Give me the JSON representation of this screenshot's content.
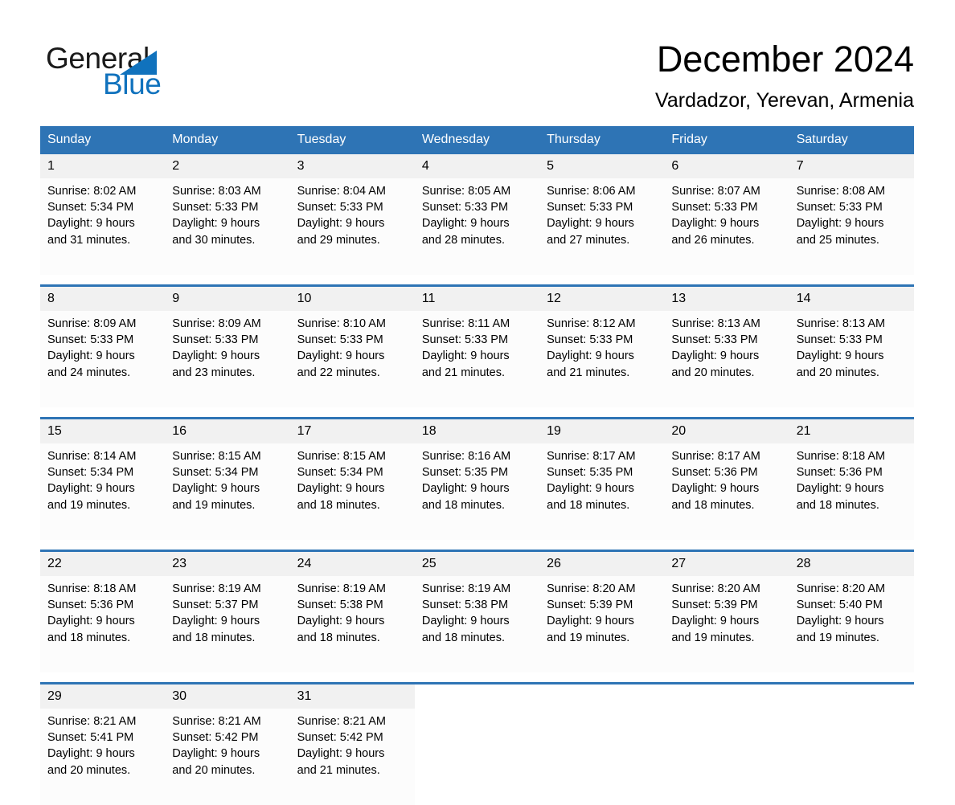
{
  "brand": {
    "word_one": "General",
    "word_two": "Blue",
    "triangle_color": "#1072bd",
    "text_color": "#1a1a1a"
  },
  "header": {
    "month_title": "December 2024",
    "location": "Vardadzor, Yerevan, Armenia"
  },
  "theme": {
    "header_blue": "#2e74b5",
    "daynum_background": "#f1f1f1",
    "cell_background": "#fcfcfc",
    "page_background": "#ffffff"
  },
  "calendar": {
    "weekday_headers": [
      "Sunday",
      "Monday",
      "Tuesday",
      "Wednesday",
      "Thursday",
      "Friday",
      "Saturday"
    ],
    "weeks": [
      {
        "days": [
          {
            "day": "1",
            "sunrise": "Sunrise: 8:02 AM",
            "sunset": "Sunset: 5:34 PM",
            "daylight_1": "Daylight: 9 hours",
            "daylight_2": "and 31 minutes."
          },
          {
            "day": "2",
            "sunrise": "Sunrise: 8:03 AM",
            "sunset": "Sunset: 5:33 PM",
            "daylight_1": "Daylight: 9 hours",
            "daylight_2": "and 30 minutes."
          },
          {
            "day": "3",
            "sunrise": "Sunrise: 8:04 AM",
            "sunset": "Sunset: 5:33 PM",
            "daylight_1": "Daylight: 9 hours",
            "daylight_2": "and 29 minutes."
          },
          {
            "day": "4",
            "sunrise": "Sunrise: 8:05 AM",
            "sunset": "Sunset: 5:33 PM",
            "daylight_1": "Daylight: 9 hours",
            "daylight_2": "and 28 minutes."
          },
          {
            "day": "5",
            "sunrise": "Sunrise: 8:06 AM",
            "sunset": "Sunset: 5:33 PM",
            "daylight_1": "Daylight: 9 hours",
            "daylight_2": "and 27 minutes."
          },
          {
            "day": "6",
            "sunrise": "Sunrise: 8:07 AM",
            "sunset": "Sunset: 5:33 PM",
            "daylight_1": "Daylight: 9 hours",
            "daylight_2": "and 26 minutes."
          },
          {
            "day": "7",
            "sunrise": "Sunrise: 8:08 AM",
            "sunset": "Sunset: 5:33 PM",
            "daylight_1": "Daylight: 9 hours",
            "daylight_2": "and 25 minutes."
          }
        ]
      },
      {
        "days": [
          {
            "day": "8",
            "sunrise": "Sunrise: 8:09 AM",
            "sunset": "Sunset: 5:33 PM",
            "daylight_1": "Daylight: 9 hours",
            "daylight_2": "and 24 minutes."
          },
          {
            "day": "9",
            "sunrise": "Sunrise: 8:09 AM",
            "sunset": "Sunset: 5:33 PM",
            "daylight_1": "Daylight: 9 hours",
            "daylight_2": "and 23 minutes."
          },
          {
            "day": "10",
            "sunrise": "Sunrise: 8:10 AM",
            "sunset": "Sunset: 5:33 PM",
            "daylight_1": "Daylight: 9 hours",
            "daylight_2": "and 22 minutes."
          },
          {
            "day": "11",
            "sunrise": "Sunrise: 8:11 AM",
            "sunset": "Sunset: 5:33 PM",
            "daylight_1": "Daylight: 9 hours",
            "daylight_2": "and 21 minutes."
          },
          {
            "day": "12",
            "sunrise": "Sunrise: 8:12 AM",
            "sunset": "Sunset: 5:33 PM",
            "daylight_1": "Daylight: 9 hours",
            "daylight_2": "and 21 minutes."
          },
          {
            "day": "13",
            "sunrise": "Sunrise: 8:13 AM",
            "sunset": "Sunset: 5:33 PM",
            "daylight_1": "Daylight: 9 hours",
            "daylight_2": "and 20 minutes."
          },
          {
            "day": "14",
            "sunrise": "Sunrise: 8:13 AM",
            "sunset": "Sunset: 5:33 PM",
            "daylight_1": "Daylight: 9 hours",
            "daylight_2": "and 20 minutes."
          }
        ]
      },
      {
        "days": [
          {
            "day": "15",
            "sunrise": "Sunrise: 8:14 AM",
            "sunset": "Sunset: 5:34 PM",
            "daylight_1": "Daylight: 9 hours",
            "daylight_2": "and 19 minutes."
          },
          {
            "day": "16",
            "sunrise": "Sunrise: 8:15 AM",
            "sunset": "Sunset: 5:34 PM",
            "daylight_1": "Daylight: 9 hours",
            "daylight_2": "and 19 minutes."
          },
          {
            "day": "17",
            "sunrise": "Sunrise: 8:15 AM",
            "sunset": "Sunset: 5:34 PM",
            "daylight_1": "Daylight: 9 hours",
            "daylight_2": "and 18 minutes."
          },
          {
            "day": "18",
            "sunrise": "Sunrise: 8:16 AM",
            "sunset": "Sunset: 5:35 PM",
            "daylight_1": "Daylight: 9 hours",
            "daylight_2": "and 18 minutes."
          },
          {
            "day": "19",
            "sunrise": "Sunrise: 8:17 AM",
            "sunset": "Sunset: 5:35 PM",
            "daylight_1": "Daylight: 9 hours",
            "daylight_2": "and 18 minutes."
          },
          {
            "day": "20",
            "sunrise": "Sunrise: 8:17 AM",
            "sunset": "Sunset: 5:36 PM",
            "daylight_1": "Daylight: 9 hours",
            "daylight_2": "and 18 minutes."
          },
          {
            "day": "21",
            "sunrise": "Sunrise: 8:18 AM",
            "sunset": "Sunset: 5:36 PM",
            "daylight_1": "Daylight: 9 hours",
            "daylight_2": "and 18 minutes."
          }
        ]
      },
      {
        "days": [
          {
            "day": "22",
            "sunrise": "Sunrise: 8:18 AM",
            "sunset": "Sunset: 5:36 PM",
            "daylight_1": "Daylight: 9 hours",
            "daylight_2": "and 18 minutes."
          },
          {
            "day": "23",
            "sunrise": "Sunrise: 8:19 AM",
            "sunset": "Sunset: 5:37 PM",
            "daylight_1": "Daylight: 9 hours",
            "daylight_2": "and 18 minutes."
          },
          {
            "day": "24",
            "sunrise": "Sunrise: 8:19 AM",
            "sunset": "Sunset: 5:38 PM",
            "daylight_1": "Daylight: 9 hours",
            "daylight_2": "and 18 minutes."
          },
          {
            "day": "25",
            "sunrise": "Sunrise: 8:19 AM",
            "sunset": "Sunset: 5:38 PM",
            "daylight_1": "Daylight: 9 hours",
            "daylight_2": "and 18 minutes."
          },
          {
            "day": "26",
            "sunrise": "Sunrise: 8:20 AM",
            "sunset": "Sunset: 5:39 PM",
            "daylight_1": "Daylight: 9 hours",
            "daylight_2": "and 19 minutes."
          },
          {
            "day": "27",
            "sunrise": "Sunrise: 8:20 AM",
            "sunset": "Sunset: 5:39 PM",
            "daylight_1": "Daylight: 9 hours",
            "daylight_2": "and 19 minutes."
          },
          {
            "day": "28",
            "sunrise": "Sunrise: 8:20 AM",
            "sunset": "Sunset: 5:40 PM",
            "daylight_1": "Daylight: 9 hours",
            "daylight_2": "and 19 minutes."
          }
        ]
      },
      {
        "days": [
          {
            "day": "29",
            "sunrise": "Sunrise: 8:21 AM",
            "sunset": "Sunset: 5:41 PM",
            "daylight_1": "Daylight: 9 hours",
            "daylight_2": "and 20 minutes."
          },
          {
            "day": "30",
            "sunrise": "Sunrise: 8:21 AM",
            "sunset": "Sunset: 5:42 PM",
            "daylight_1": "Daylight: 9 hours",
            "daylight_2": "and 20 minutes."
          },
          {
            "day": "31",
            "sunrise": "Sunrise: 8:21 AM",
            "sunset": "Sunset: 5:42 PM",
            "daylight_1": "Daylight: 9 hours",
            "daylight_2": "and 21 minutes."
          },
          {
            "day": "",
            "sunrise": "",
            "sunset": "",
            "daylight_1": "",
            "daylight_2": ""
          },
          {
            "day": "",
            "sunrise": "",
            "sunset": "",
            "daylight_1": "",
            "daylight_2": ""
          },
          {
            "day": "",
            "sunrise": "",
            "sunset": "",
            "daylight_1": "",
            "daylight_2": ""
          },
          {
            "day": "",
            "sunrise": "",
            "sunset": "",
            "daylight_1": "",
            "daylight_2": ""
          }
        ]
      }
    ]
  }
}
